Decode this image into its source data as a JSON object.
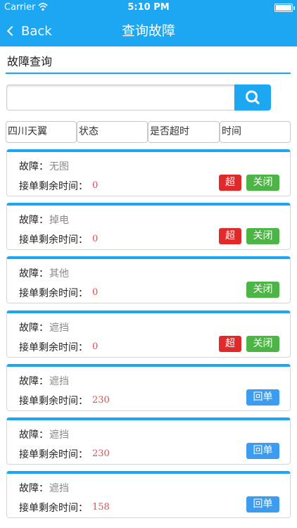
{
  "status_bar": {
    "carrier": "Carrier",
    "time": "5:10 PM",
    "wifi_icon": "wifi-icon",
    "battery_icon": "battery-icon"
  },
  "nav": {
    "back_label": "Back",
    "title": "查询故障"
  },
  "section": {
    "title": "故障查询"
  },
  "search": {
    "value": "",
    "placeholder": "",
    "icon": "search-icon"
  },
  "filters": [
    {
      "label": "四川天翼"
    },
    {
      "label": "状态"
    },
    {
      "label": "是否超时"
    },
    {
      "label": "时间"
    }
  ],
  "cards": [
    {
      "fault_label": "故障：",
      "fault": "无图",
      "remain_label": "接单剩余时间：",
      "remain": "0",
      "buttons": [
        "超",
        "关闭"
      ]
    },
    {
      "fault_label": "故障：",
      "fault": "掉电",
      "remain_label": "接单剩余时间：",
      "remain": "0",
      "buttons": [
        "超",
        "关闭"
      ]
    },
    {
      "fault_label": "故障：",
      "fault": "其他",
      "remain_label": "接单剩余时间：",
      "remain": "0",
      "buttons": [
        "关闭"
      ]
    },
    {
      "fault_label": "故障：",
      "fault": "遮挡",
      "remain_label": "接单剩余时间：",
      "remain": "0",
      "buttons": [
        "超",
        "关闭"
      ]
    },
    {
      "fault_label": "故障：",
      "fault": "遮挡",
      "remain_label": "接单剩余时间：",
      "remain": "230",
      "buttons": [
        "回单"
      ]
    },
    {
      "fault_label": "故障：",
      "fault": "遮挡",
      "remain_label": "接单剩余时间：",
      "remain": "230",
      "buttons": [
        "回单"
      ]
    },
    {
      "fault_label": "故障：",
      "fault": "遮挡",
      "remain_label": "接单剩余时间：",
      "remain": "158",
      "buttons": [
        "回单"
      ]
    }
  ],
  "colors": {
    "accent": "#1da7f2",
    "overtime": "#e02a2a",
    "close": "#4db546",
    "return": "#3b9cf0",
    "remain_value": "#e64a4a"
  }
}
